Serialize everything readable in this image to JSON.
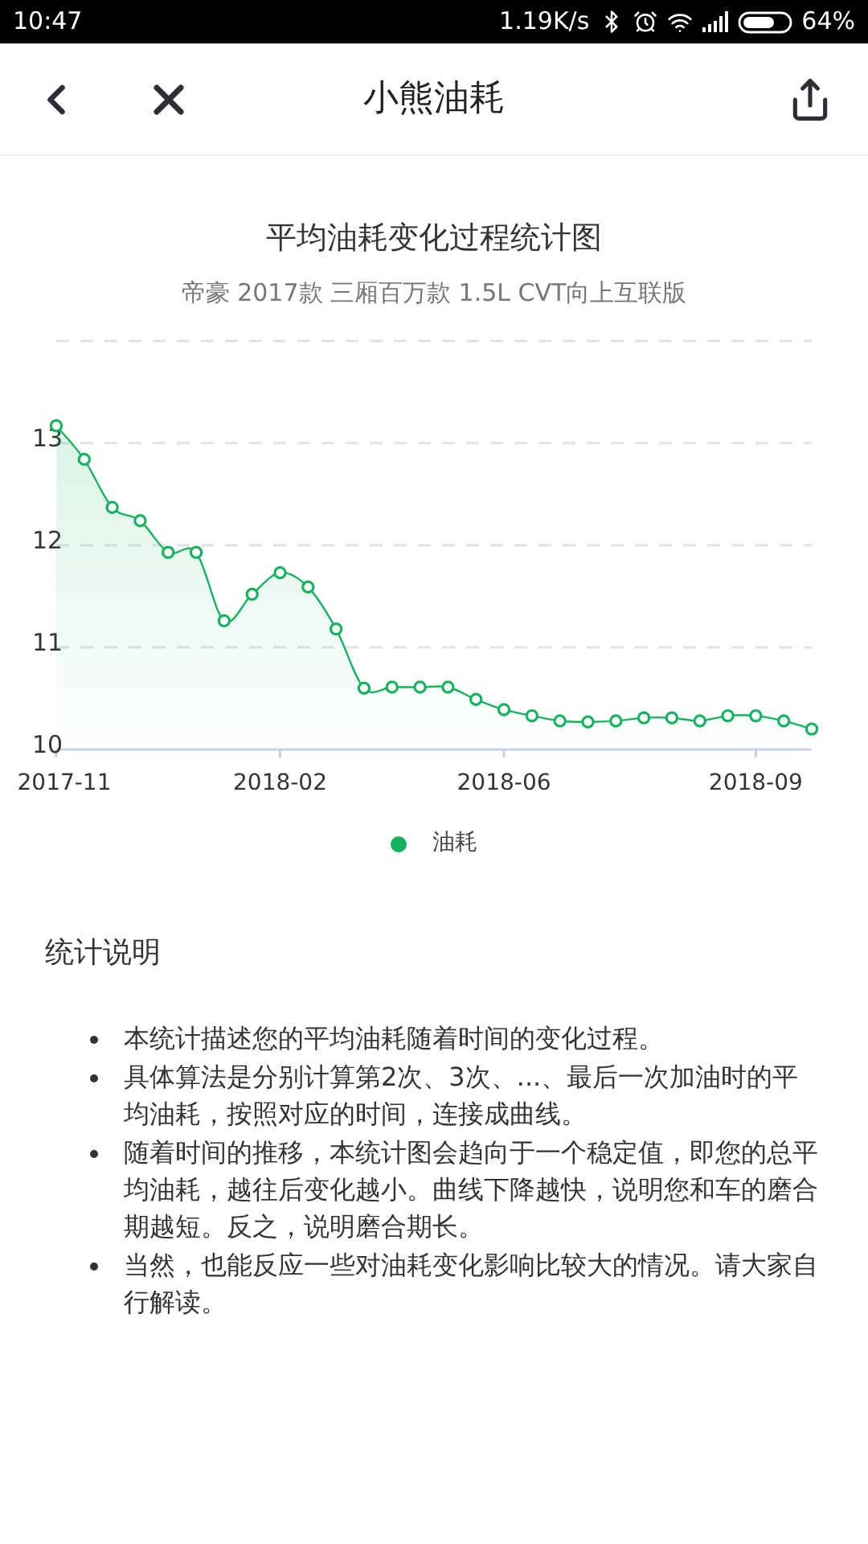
{
  "status_bar": {
    "time": "10:47",
    "speed": "1.19K/s",
    "battery": "64%"
  },
  "header": {
    "title": "小熊油耗"
  },
  "chart": {
    "title": "平均油耗变化过程统计图",
    "subtitle": "帝豪 2017款 三厢百万款 1.5L CVT向上互联版",
    "chart_data": {
      "type": "area",
      "categories": [
        "2017-11",
        null,
        null,
        null,
        null,
        null,
        null,
        null,
        "2018-02",
        null,
        null,
        null,
        null,
        null,
        null,
        null,
        "2018-06",
        null,
        null,
        null,
        null,
        null,
        null,
        null,
        null,
        "2018-09",
        null,
        null
      ],
      "series": [
        {
          "name": "油耗",
          "color": "#14b35e",
          "values": [
            13.17,
            12.84,
            12.37,
            12.24,
            11.93,
            11.93,
            11.26,
            11.52,
            11.73,
            11.59,
            11.18,
            10.6,
            10.61,
            10.61,
            10.61,
            10.49,
            10.39,
            10.33,
            10.28,
            10.27,
            10.28,
            10.31,
            10.31,
            10.28,
            10.33,
            10.33,
            10.28,
            10.2
          ]
        }
      ],
      "ylim": [
        10,
        14
      ],
      "grid": true,
      "yticks": [
        10,
        11,
        12,
        13
      ]
    }
  },
  "notes": {
    "heading": "统计说明",
    "items": [
      "本统计描述您的平均油耗随着时间的变化过程。",
      "具体算法是分别计算第2次、3次、...、最后一次加油时的平均油耗，按照对应的时间，连接成曲线。",
      "随着时间的推移，本统计图会趋向于一个稳定值，即您的总平均油耗，越往后变化越小。曲线下降越快，说明您和车的磨合期越短。反之，说明磨合期长。",
      "当然，也能反应一些对油耗变化影响比较大的情况。请大家自行解读。"
    ]
  }
}
